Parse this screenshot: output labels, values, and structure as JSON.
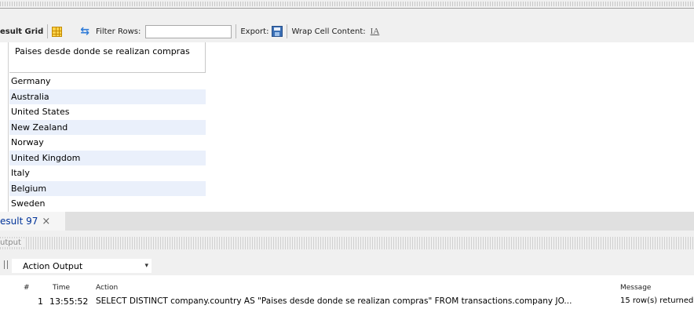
{
  "toolbar": {
    "result_grid_label": "esult Grid",
    "filter_label": "Filter Rows:",
    "filter_value": "",
    "export_label": "Export:",
    "wrap_label": "Wrap Cell Content:",
    "wrap_icon_glyph": "IA"
  },
  "grid": {
    "column_header": "Paises desde donde se realizan compras",
    "rows": [
      "Germany",
      "Australia",
      "United States",
      "New Zealand",
      "Norway",
      "United Kingdom",
      "Italy",
      "Belgium",
      "Sweden"
    ]
  },
  "result_tab": {
    "label": "esult 97",
    "close_glyph": "×"
  },
  "output": {
    "header_label": "utput",
    "selector_value": "Action Output",
    "selector_arrow": "▾",
    "columns": {
      "num": "#",
      "time": "Time",
      "action": "Action",
      "message": "Message"
    },
    "entries": [
      {
        "num": "1",
        "time": "13:55:52",
        "action": "SELECT DISTINCT company.country AS \"Paises desde donde se realizan compras\" FROM transactions.company  JO...",
        "message": "15 row(s) returned"
      }
    ]
  },
  "colors": {
    "row_alt": "#eaf0fb",
    "tab_text": "#003399",
    "toolbar_bg": "#f0f0f0"
  },
  "icons": {
    "grid": "grid-layout-icon",
    "refresh": "refresh-icon",
    "export": "save-icon",
    "wrap": "wrap-text-icon"
  }
}
